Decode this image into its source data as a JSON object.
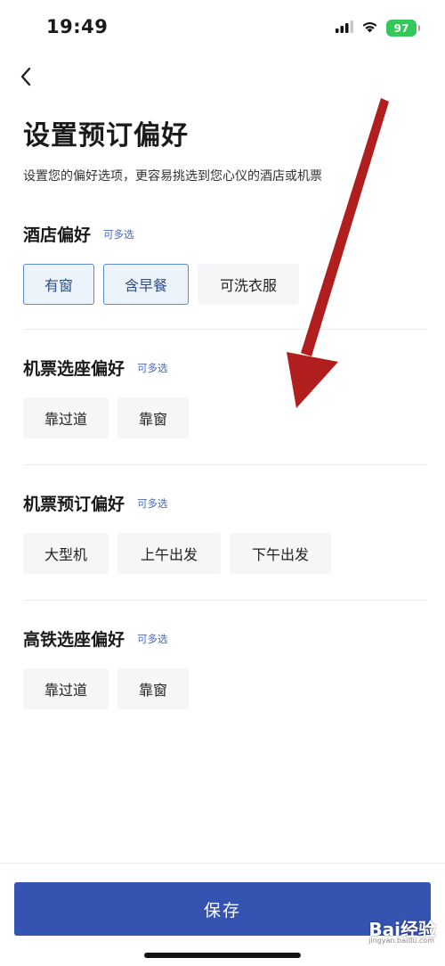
{
  "status_bar": {
    "time": "19:49",
    "battery": "97",
    "signal_icon": "cellular-signal-icon",
    "wifi_icon": "wifi-icon",
    "battery_icon": "battery-charging-icon"
  },
  "nav": {
    "back_icon": "chevron-left-icon"
  },
  "header": {
    "title": "设置预订偏好",
    "subtitle": "设置您的偏好选项，更容易挑选到您心仪的酒店或机票"
  },
  "sections": [
    {
      "title": "酒店偏好",
      "hint": "可多选",
      "options": [
        {
          "label": "有窗",
          "selected": true
        },
        {
          "label": "含早餐",
          "selected": true
        },
        {
          "label": "可洗衣服",
          "selected": false
        }
      ]
    },
    {
      "title": "机票选座偏好",
      "hint": "可多选",
      "options": [
        {
          "label": "靠过道",
          "selected": false
        },
        {
          "label": "靠窗",
          "selected": false
        }
      ]
    },
    {
      "title": "机票预订偏好",
      "hint": "可多选",
      "options": [
        {
          "label": "大型机",
          "selected": false
        },
        {
          "label": "上午出发",
          "selected": false
        },
        {
          "label": "下午出发",
          "selected": false
        }
      ]
    },
    {
      "title": "高铁选座偏好",
      "hint": "可多选",
      "options": [
        {
          "label": "靠过道",
          "selected": false
        },
        {
          "label": "靠窗",
          "selected": false
        }
      ]
    }
  ],
  "footer": {
    "save_label": "保存"
  },
  "watermark": {
    "brand": "Bai经验",
    "site": "jingyan.baidu.com"
  },
  "colors": {
    "primary": "#3553b0",
    "selected_border": "#5a8cc8",
    "hint": "#4a6ab8",
    "annotation_arrow": "#b01e1e",
    "battery": "#34c759"
  }
}
